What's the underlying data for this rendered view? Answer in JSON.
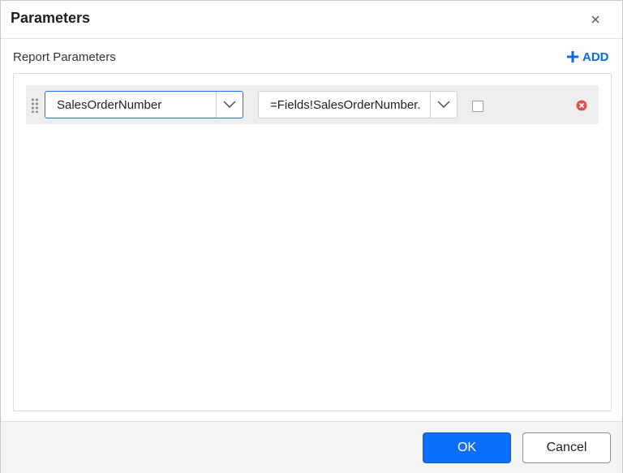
{
  "dialog": {
    "title": "Parameters",
    "close_icon": "close-icon"
  },
  "section": {
    "title": "Report Parameters",
    "add_label": "ADD",
    "add_icon": "plus-icon"
  },
  "parameters": [
    {
      "name": "SalesOrderNumber",
      "value": "=Fields!SalesOrderNumber.",
      "checkbox_checked": false
    }
  ],
  "footer": {
    "ok_label": "OK",
    "cancel_label": "Cancel"
  },
  "colors": {
    "accent": "#0d6efd",
    "add_link": "#0a6cd8",
    "remove_icon": "#d9534f",
    "row_background": "#eeeeee"
  }
}
